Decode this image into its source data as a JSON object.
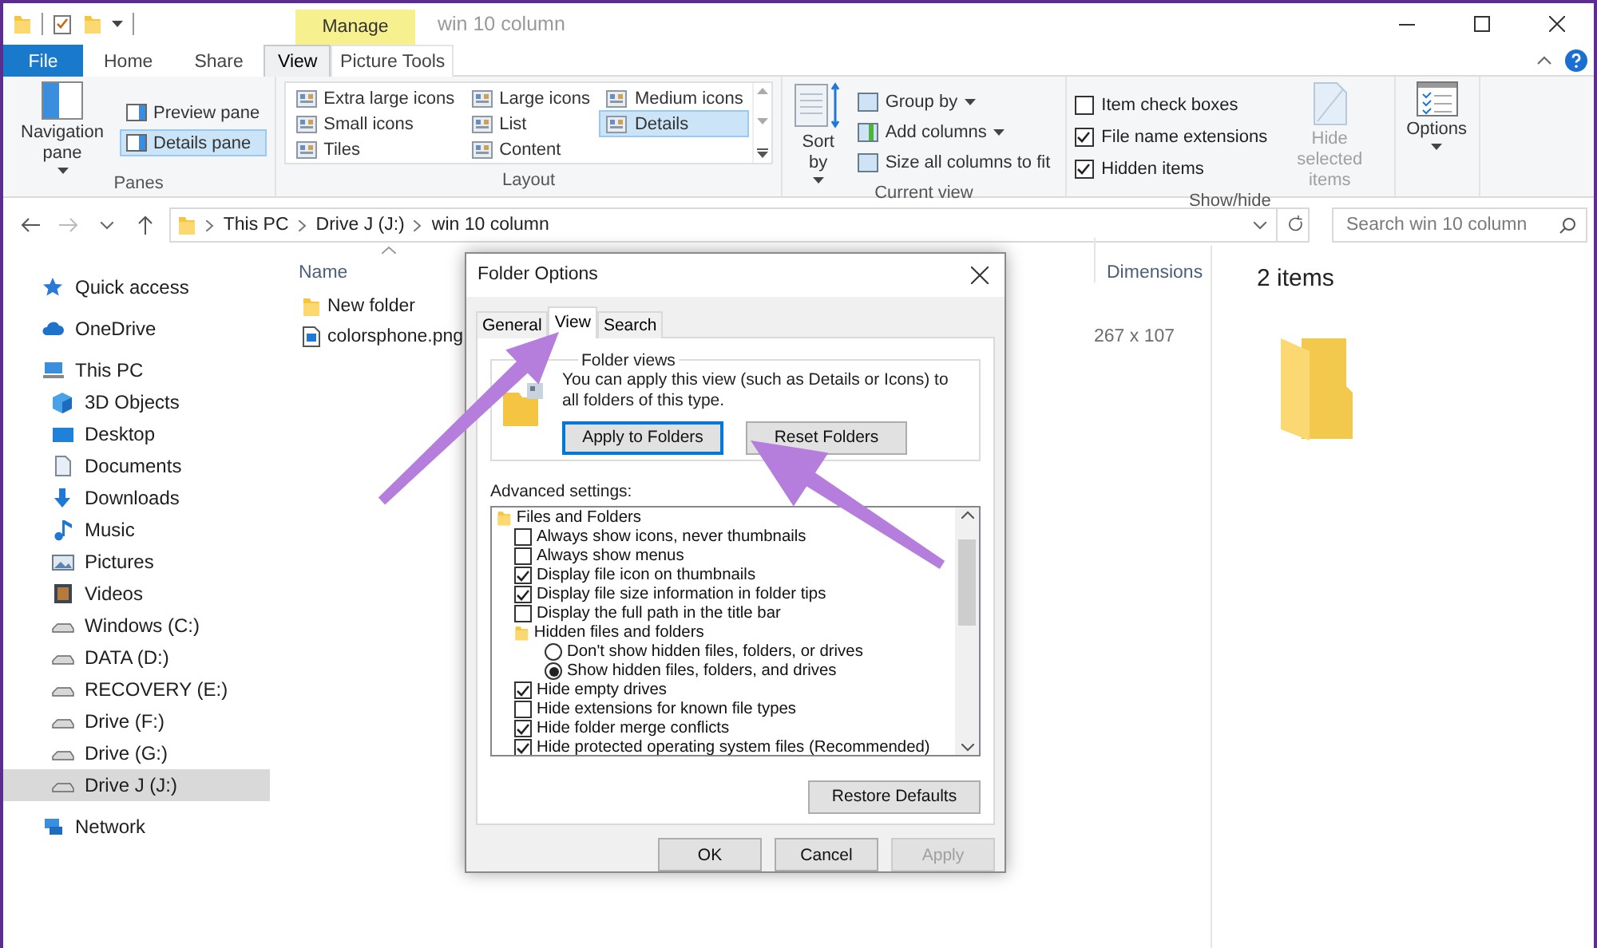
{
  "title_bar": {
    "contextual_group": "Manage",
    "title": "win 10 column"
  },
  "ribbon_tabs": [
    {
      "label": "File",
      "kind": "file",
      "selected": false
    },
    {
      "label": "Home",
      "kind": "tab",
      "selected": false
    },
    {
      "label": "Share",
      "kind": "tab",
      "selected": false
    },
    {
      "label": "View",
      "kind": "tab",
      "selected": true
    },
    {
      "label": "Picture Tools",
      "kind": "contextual",
      "selected": false
    }
  ],
  "ribbon": {
    "panes": {
      "label": "Panes",
      "navigation_pane": "Navigation pane",
      "items": [
        {
          "label": "Preview pane",
          "selected": false
        },
        {
          "label": "Details pane",
          "selected": true
        }
      ]
    },
    "layout": {
      "label": "Layout",
      "items": [
        {
          "label": "Extra large icons",
          "selected": false
        },
        {
          "label": "Large icons",
          "selected": false
        },
        {
          "label": "Medium icons",
          "selected": false
        },
        {
          "label": "Small icons",
          "selected": false
        },
        {
          "label": "List",
          "selected": false
        },
        {
          "label": "Details",
          "selected": true
        },
        {
          "label": "Tiles",
          "selected": false
        },
        {
          "label": "Content",
          "selected": false
        }
      ]
    },
    "current_view": {
      "label": "Current view",
      "sort_by": "Sort by",
      "items": [
        "Group by",
        "Add columns",
        "Size all columns to fit"
      ]
    },
    "show_hide": {
      "label": "Show/hide",
      "checkboxes": [
        {
          "label": "Item check boxes",
          "checked": false
        },
        {
          "label": "File name extensions",
          "checked": true
        },
        {
          "label": "Hidden items",
          "checked": true
        }
      ],
      "hide_selected": {
        "label": "Hide selected items",
        "disabled": true
      }
    },
    "options": {
      "label": "Options"
    }
  },
  "address_bar": {
    "path": [
      "This PC",
      "Drive J (J:)",
      "win 10 column"
    ],
    "search_placeholder": "Search win 10 column"
  },
  "nav_pane": [
    {
      "label": "Quick access",
      "kind": "star",
      "selected": false
    },
    {
      "label": "OneDrive",
      "kind": "cloud",
      "selected": false
    },
    {
      "label": "This PC",
      "kind": "pc",
      "selected": false,
      "children": [
        {
          "label": "3D Objects",
          "kind": "cube",
          "selected": false
        },
        {
          "label": "Desktop",
          "kind": "desktop",
          "selected": false
        },
        {
          "label": "Documents",
          "kind": "document",
          "selected": false
        },
        {
          "label": "Downloads",
          "kind": "download",
          "selected": false
        },
        {
          "label": "Music",
          "kind": "music",
          "selected": false
        },
        {
          "label": "Pictures",
          "kind": "picture",
          "selected": false
        },
        {
          "label": "Videos",
          "kind": "video",
          "selected": false
        },
        {
          "label": "Windows (C:)",
          "kind": "drive",
          "selected": false
        },
        {
          "label": "DATA (D:)",
          "kind": "drive",
          "selected": false
        },
        {
          "label": "RECOVERY (E:)",
          "kind": "drive",
          "selected": false
        },
        {
          "label": "Drive (F:)",
          "kind": "drive",
          "selected": false
        },
        {
          "label": "Drive (G:)",
          "kind": "drive",
          "selected": false
        },
        {
          "label": "Drive J (J:)",
          "kind": "drive",
          "selected": true
        }
      ]
    },
    {
      "label": "Network",
      "kind": "network",
      "selected": false
    }
  ],
  "file_list": {
    "columns": [
      "Name",
      "Dimensions"
    ],
    "rows": [
      {
        "name": "New folder",
        "kind": "folder"
      },
      {
        "name": "colorsphone.png",
        "kind": "image",
        "dimensions": "267 x 107"
      }
    ]
  },
  "preview_pane": {
    "count": "2 items"
  },
  "dialog": {
    "title": "Folder Options",
    "tabs": [
      {
        "label": "General",
        "selected": false
      },
      {
        "label": "View",
        "selected": true
      },
      {
        "label": "Search",
        "selected": false
      }
    ],
    "folder_views": {
      "label": "Folder views",
      "text": "You can apply this view (such as Details or Icons) to all folders of this type.",
      "buttons": [
        {
          "label": "Apply to Folders",
          "focused": true
        },
        {
          "label": "Reset Folders",
          "focused": false
        }
      ]
    },
    "advanced_label": "Advanced settings:",
    "advanced": [
      {
        "label": "Files and Folders",
        "kind": "group",
        "children": [
          {
            "label": "Always show icons, never thumbnails",
            "kind": "checkbox",
            "checked": false
          },
          {
            "label": "Always show menus",
            "kind": "checkbox",
            "checked": false
          },
          {
            "label": "Display file icon on thumbnails",
            "kind": "checkbox",
            "checked": true
          },
          {
            "label": "Display file size information in folder tips",
            "kind": "checkbox",
            "checked": true
          },
          {
            "label": "Display the full path in the title bar",
            "kind": "checkbox",
            "checked": false
          },
          {
            "label": "Hidden files and folders",
            "kind": "group",
            "children": [
              {
                "label": "Don't show hidden files, folders, or drives",
                "kind": "radio",
                "selected": false
              },
              {
                "label": "Show hidden files, folders, and drives",
                "kind": "radio",
                "selected": true
              }
            ]
          },
          {
            "label": "Hide empty drives",
            "kind": "checkbox",
            "checked": true
          },
          {
            "label": "Hide extensions for known file types",
            "kind": "checkbox",
            "checked": false
          },
          {
            "label": "Hide folder merge conflicts",
            "kind": "checkbox",
            "checked": true
          },
          {
            "label": "Hide protected operating system files (Recommended)",
            "kind": "checkbox",
            "checked": true
          }
        ]
      }
    ],
    "restore_button": "Restore Defaults",
    "buttons": [
      {
        "label": "OK",
        "disabled": false
      },
      {
        "label": "Cancel",
        "disabled": false
      },
      {
        "label": "Apply",
        "disabled": true
      }
    ]
  }
}
